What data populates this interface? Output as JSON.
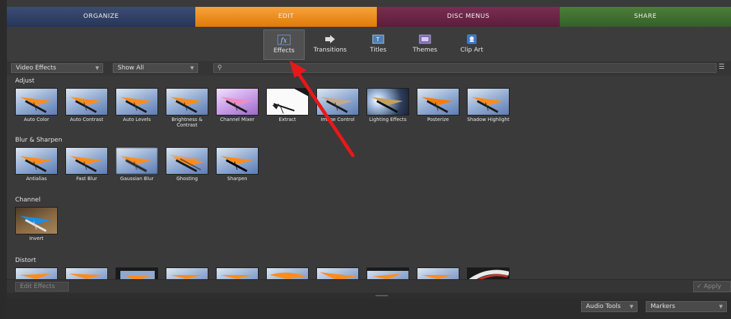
{
  "tabs": {
    "organize": "ORGANIZE",
    "edit": "EDIT",
    "disc_menus": "DISC MENUS",
    "share": "SHARE"
  },
  "toolbar": {
    "effects": "Effects",
    "transitions": "Transitions",
    "titles": "Titles",
    "themes": "Themes",
    "clip_art": "Clip Art"
  },
  "filters": {
    "type_select": "Video Effects",
    "show_select": "Show All",
    "search_value": ""
  },
  "categories": {
    "adjust": {
      "label": "Adjust",
      "items": [
        "Auto Color",
        "Auto Contrast",
        "Auto Levels",
        "Brightness & Contrast",
        "Channel Mixer",
        "Extract",
        "Image Control",
        "Lighting Effects",
        "Posterize",
        "Shadow Highlight"
      ]
    },
    "blur_sharpen": {
      "label": "Blur & Sharpen",
      "items": [
        "Antialias",
        "Fast Blur",
        "Gaussian Blur",
        "Ghosting",
        "Sharpen"
      ]
    },
    "channel": {
      "label": "Channel",
      "items": [
        "Invert"
      ]
    },
    "distort": {
      "label": "Distort"
    }
  },
  "bottom": {
    "edit_effects": "Edit Effects",
    "apply": "Apply",
    "audio_tools": "Audio Tools",
    "markers": "Markers"
  },
  "colors": {
    "edit_tab": "#f0901f",
    "organize_tab": "#2f3f66",
    "disc_tab": "#6a2446",
    "share_tab": "#3f6e30",
    "annotation_arrow": "#e81818"
  }
}
